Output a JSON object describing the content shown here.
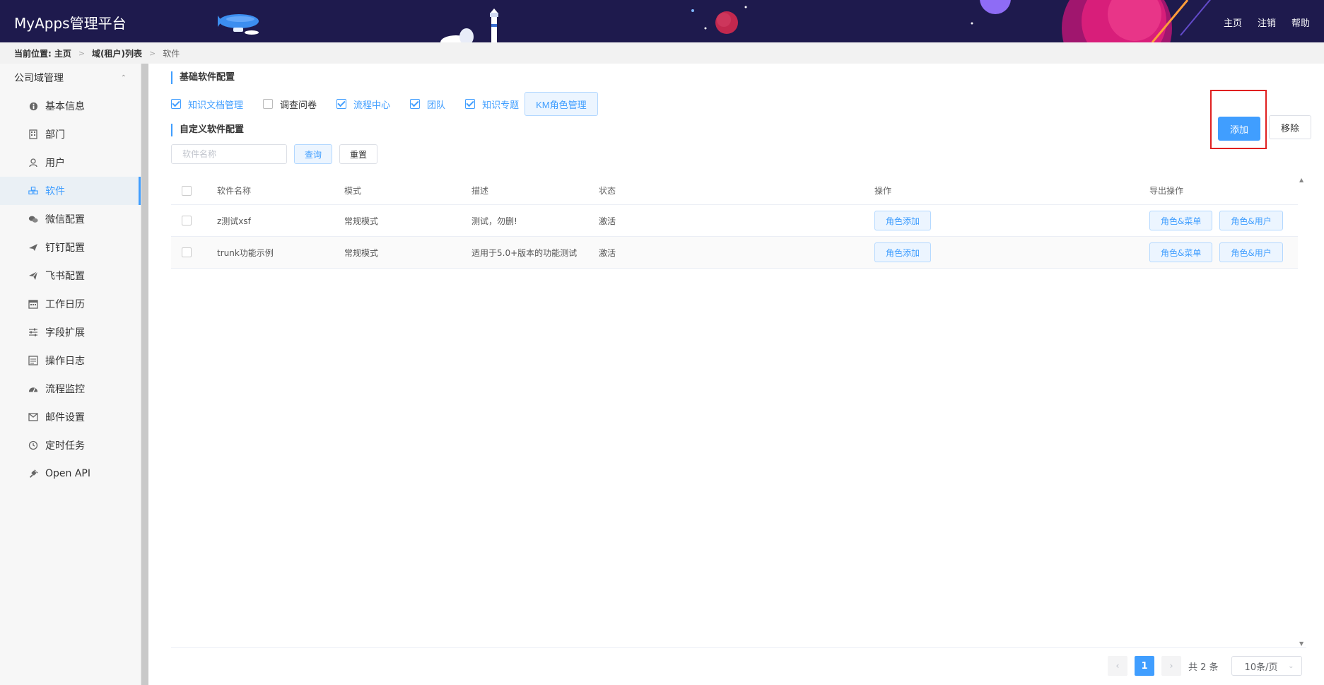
{
  "app": {
    "title": "MyApps管理平台"
  },
  "header": {
    "links": [
      "主页",
      "注销",
      "帮助"
    ]
  },
  "breadcrumb": {
    "prefix": "当前位置:",
    "items": [
      "主页",
      "域(租户)列表"
    ],
    "current": "软件"
  },
  "sidebar": {
    "group": "公司域管理",
    "items": [
      {
        "label": "基本信息",
        "icon": "info-icon"
      },
      {
        "label": "部门",
        "icon": "building-icon"
      },
      {
        "label": "用户",
        "icon": "user-icon"
      },
      {
        "label": "软件",
        "icon": "cubes-icon"
      },
      {
        "label": "微信配置",
        "icon": "wechat-icon"
      },
      {
        "label": "钉钉配置",
        "icon": "plane-icon"
      },
      {
        "label": "飞书配置",
        "icon": "paper-plane-icon"
      },
      {
        "label": "工作日历",
        "icon": "calendar-icon"
      },
      {
        "label": "字段扩展",
        "icon": "sliders-icon"
      },
      {
        "label": "操作日志",
        "icon": "log-icon"
      },
      {
        "label": "流程监控",
        "icon": "dashboard-icon"
      },
      {
        "label": "邮件设置",
        "icon": "mail-icon"
      },
      {
        "label": "定时任务",
        "icon": "clock-icon"
      },
      {
        "label": "Open API",
        "icon": "plug-icon"
      }
    ]
  },
  "basic": {
    "title": "基础软件配置",
    "checks": [
      {
        "label": "知识文档管理",
        "checked": true
      },
      {
        "label": "调查问卷",
        "checked": false
      },
      {
        "label": "流程中心",
        "checked": true
      },
      {
        "label": "团队",
        "checked": true
      },
      {
        "label": "知识专题",
        "checked": true
      }
    ],
    "km_button": "KM角色管理"
  },
  "custom": {
    "title": "自定义软件配置",
    "search_placeholder": "软件名称",
    "query_label": "查询",
    "reset_label": "重置",
    "add_label": "添加",
    "remove_label": "移除"
  },
  "table": {
    "headers": [
      "软件名称",
      "模式",
      "描述",
      "状态",
      "操作",
      "导出操作"
    ],
    "rows": [
      {
        "name": "z测试xsf",
        "mode": "常规模式",
        "desc": "测试，勿删!",
        "status": "激活",
        "op": "角色添加",
        "exp1": "角色&菜单",
        "exp2": "角色&用户"
      },
      {
        "name": "trunk功能示例",
        "mode": "常规模式",
        "desc": "适用于5.0+版本的功能测试",
        "status": "激活",
        "op": "角色添加",
        "exp1": "角色&菜单",
        "exp2": "角色&用户"
      }
    ]
  },
  "pagination": {
    "current": "1",
    "total": "共 2 条",
    "page_size": "10条/页"
  }
}
